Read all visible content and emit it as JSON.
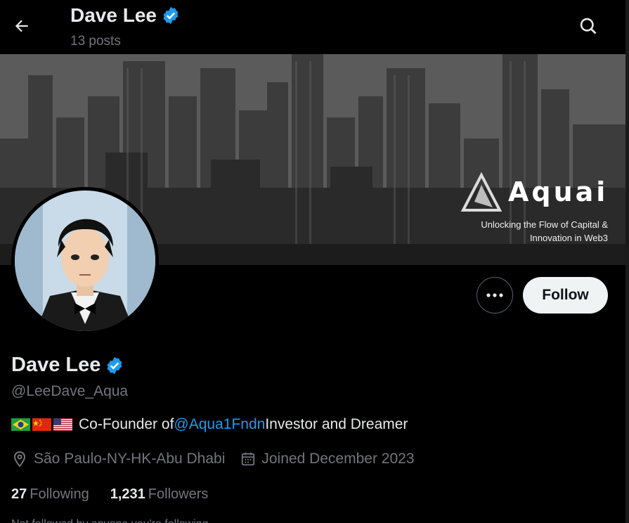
{
  "header": {
    "title": "Dave Lee",
    "post_count": "13 posts"
  },
  "banner": {
    "brand_name": "Aquai",
    "tagline_line1": "Unlocking the Flow of Capital &",
    "tagline_line2": "Innovation in Web3"
  },
  "actions": {
    "follow_label": "Follow"
  },
  "profile": {
    "name": "Dave Lee",
    "handle": "@LeeDave_Aqua",
    "bio_prefix": "Co-Founder of ",
    "bio_mention": "@Aqua1Fndn",
    "bio_suffix": " Investor and Dreamer",
    "flags": [
      "brazil-flag-icon",
      "china-flag-icon",
      "usa-flag-icon"
    ],
    "location": "São Paulo-NY-HK-Abu Dhabi",
    "joined": "Joined December 2023"
  },
  "stats": {
    "following_count": "27",
    "following_label": "Following",
    "followers_count": "1,231",
    "followers_label": "Followers"
  },
  "footer_cutoff": "Not followed by anyone you're following",
  "colors": {
    "background": "#000000",
    "text": "#e7e9ea",
    "secondary": "#71767b",
    "accent": "#1d9bf0",
    "verified": "#1d9bf0"
  }
}
